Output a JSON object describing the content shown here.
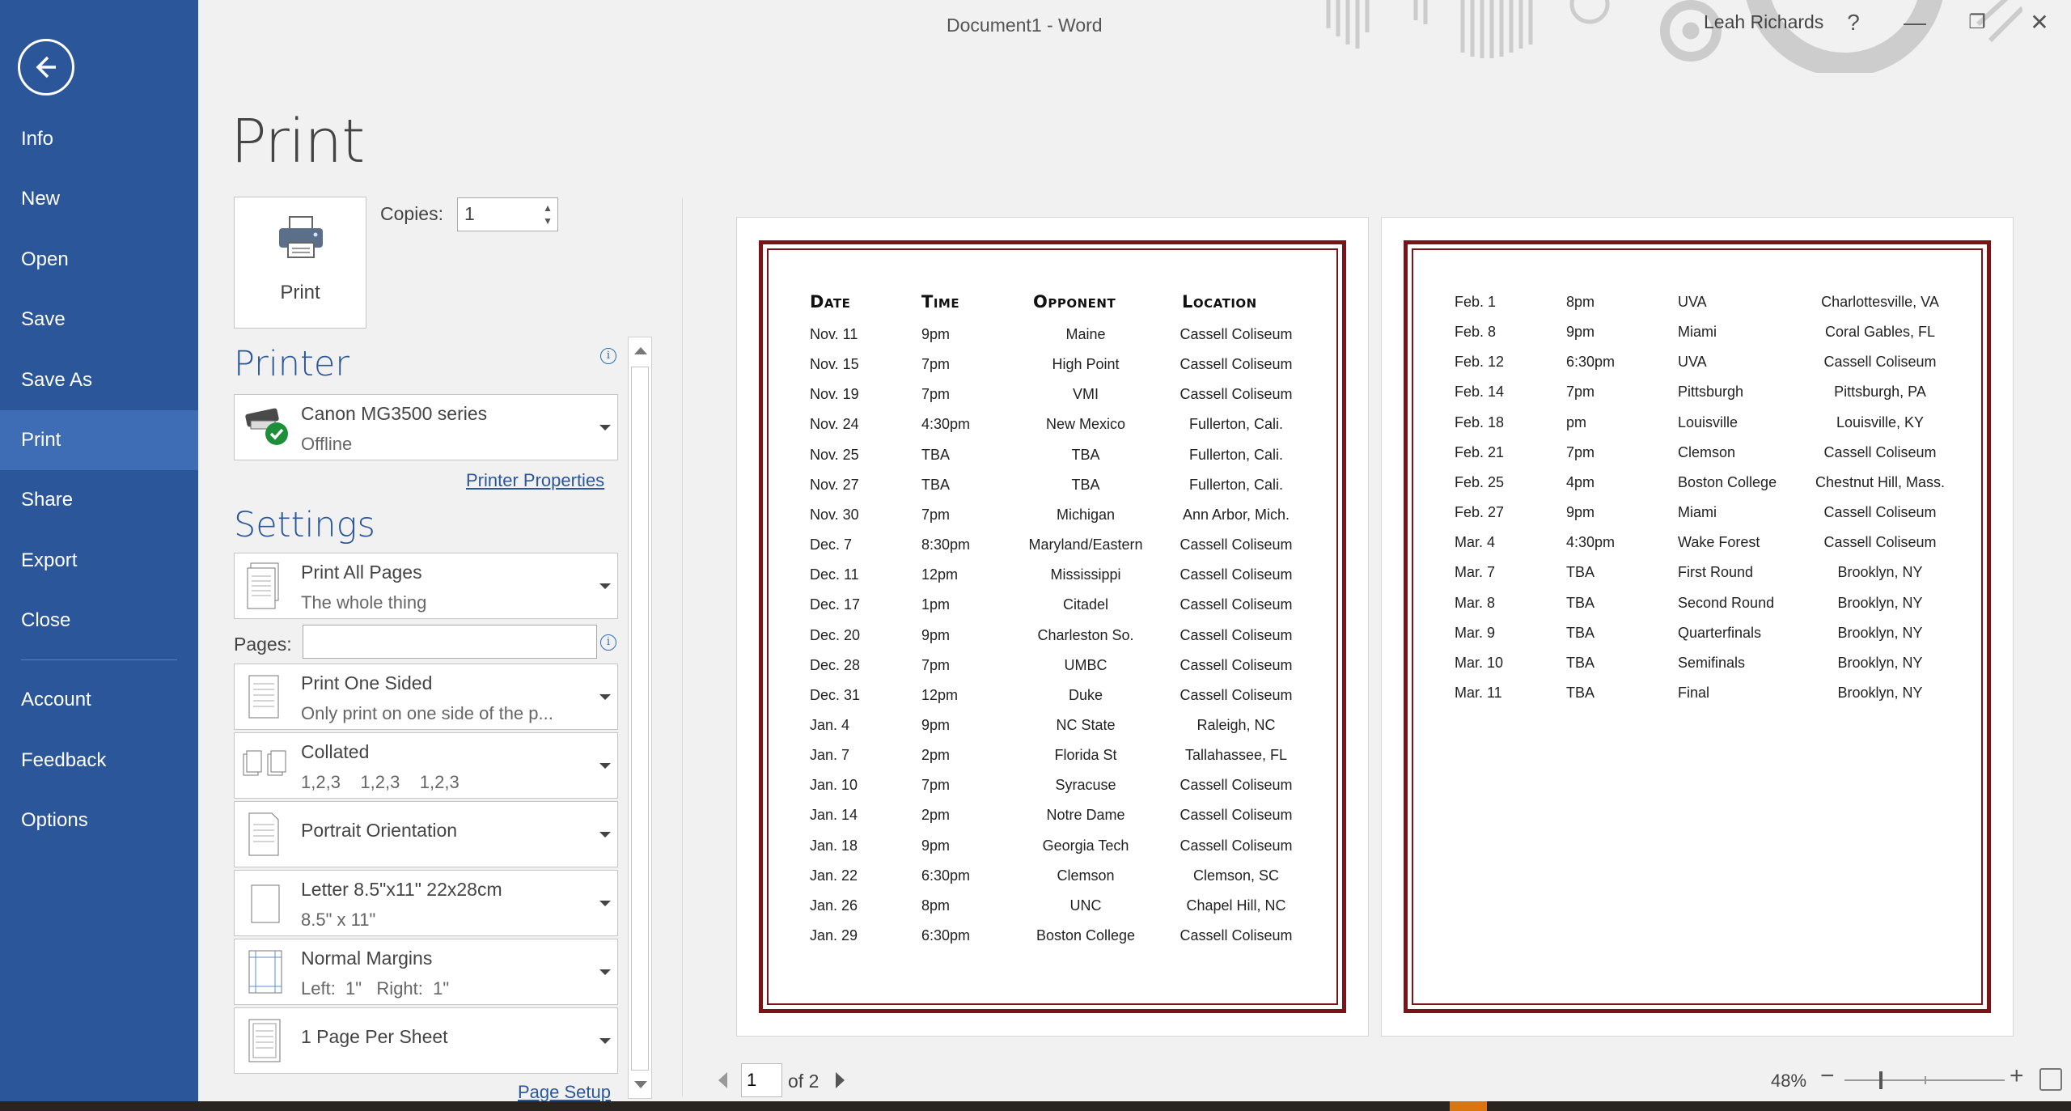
{
  "window": {
    "title": "Document1  -  Word",
    "user": "Leah Richards",
    "help": "?",
    "minimize": "—",
    "restore": "❐",
    "close": "✕"
  },
  "nav": {
    "back_icon": "back-arrow-icon",
    "items": [
      "Info",
      "New",
      "Open",
      "Save",
      "Save As",
      "Print",
      "Share",
      "Export",
      "Close",
      "Account",
      "Feedback",
      "Options"
    ],
    "active": "Print",
    "color": "#2b579a"
  },
  "print": {
    "heading": "Print",
    "button_label": "Print",
    "copies_label": "Copies:",
    "copies_value": "1"
  },
  "printer": {
    "title": "Printer",
    "name": "Canon MG3500 series",
    "status": "Offline",
    "properties_link": "Printer Properties"
  },
  "settings": {
    "title": "Settings",
    "pages_label": "Pages:",
    "pages_value": "",
    "options": [
      {
        "line1": "Print All Pages",
        "line2": "The whole thing"
      },
      {
        "line1": "Print One Sided",
        "line2": "Only print on one side of the p..."
      },
      {
        "line1": "Collated",
        "line2": "1,2,3    1,2,3    1,2,3"
      },
      {
        "line1": "Portrait Orientation",
        "line2": ""
      },
      {
        "line1": "Letter 8.5\"x11\" 22x28cm",
        "line2": "8.5\" x 11\""
      },
      {
        "line1": "Normal Margins",
        "line2": "Left:  1\"   Right:  1\""
      },
      {
        "line1": "1 Page Per Sheet",
        "line2": ""
      }
    ],
    "page_setup_link": "Page Setup"
  },
  "preview": {
    "page1": {
      "headers": [
        "Date",
        "Time",
        "Opponent",
        "Location"
      ],
      "rows": [
        [
          "Nov. 11",
          "9pm",
          "Maine",
          "Cassell Coliseum"
        ],
        [
          "Nov. 15",
          "7pm",
          "High Point",
          "Cassell Coliseum"
        ],
        [
          "Nov. 19",
          "7pm",
          "VMI",
          "Cassell Coliseum"
        ],
        [
          "Nov. 24",
          "4:30pm",
          "New Mexico",
          "Fullerton, Cali."
        ],
        [
          "Nov. 25",
          "TBA",
          "TBA",
          "Fullerton, Cali."
        ],
        [
          "Nov. 27",
          "TBA",
          "TBA",
          "Fullerton, Cali."
        ],
        [
          "Nov. 30",
          "7pm",
          "Michigan",
          "Ann Arbor, Mich."
        ],
        [
          "Dec. 7",
          "8:30pm",
          "Maryland/Eastern",
          "Cassell Coliseum"
        ],
        [
          "Dec. 11",
          "12pm",
          "Mississippi",
          "Cassell Coliseum"
        ],
        [
          "Dec. 17",
          "1pm",
          "Citadel",
          "Cassell Coliseum"
        ],
        [
          "Dec. 20",
          "9pm",
          "Charleston So.",
          "Cassell Coliseum"
        ],
        [
          "Dec. 28",
          "7pm",
          "UMBC",
          "Cassell Coliseum"
        ],
        [
          "Dec. 31",
          "12pm",
          "Duke",
          "Cassell Coliseum"
        ],
        [
          "Jan. 4",
          "9pm",
          "NC State",
          "Raleigh, NC"
        ],
        [
          "Jan. 7",
          "2pm",
          "Florida St",
          "Tallahassee, FL"
        ],
        [
          "Jan. 10",
          "7pm",
          "Syracuse",
          "Cassell Coliseum"
        ],
        [
          "Jan. 14",
          "2pm",
          "Notre Dame",
          "Cassell Coliseum"
        ],
        [
          "Jan. 18",
          "9pm",
          "Georgia Tech",
          "Cassell Coliseum"
        ],
        [
          "Jan. 22",
          "6:30pm",
          "Clemson",
          "Clemson, SC"
        ],
        [
          "Jan. 26",
          "8pm",
          "UNC",
          "Chapel Hill, NC"
        ],
        [
          "Jan. 29",
          "6:30pm",
          "Boston College",
          "Cassell Coliseum"
        ]
      ]
    },
    "page2": {
      "rows": [
        [
          "Feb. 1",
          "8pm",
          "UVA",
          "Charlottesville, VA"
        ],
        [
          "Feb. 8",
          "9pm",
          "Miami",
          "Coral Gables, FL"
        ],
        [
          "Feb. 12",
          "6:30pm",
          "UVA",
          "Cassell Coliseum"
        ],
        [
          "Feb. 14",
          "7pm",
          "Pittsburgh",
          "Pittsburgh, PA"
        ],
        [
          "Feb. 18",
          "pm",
          "Louisville",
          "Louisville, KY"
        ],
        [
          "Feb. 21",
          "7pm",
          "Clemson",
          "Cassell Coliseum"
        ],
        [
          "Feb. 25",
          "4pm",
          "Boston College",
          "Chestnut Hill, Mass."
        ],
        [
          "Feb. 27",
          "9pm",
          "Miami",
          "Cassell Coliseum"
        ],
        [
          "Mar. 4",
          "4:30pm",
          "Wake Forest",
          "Cassell Coliseum"
        ],
        [
          "Mar. 7",
          "TBA",
          "First Round",
          "Brooklyn, NY"
        ],
        [
          "Mar. 8",
          "TBA",
          "Second Round",
          "Brooklyn, NY"
        ],
        [
          "Mar. 9",
          "TBA",
          "Quarterfinals",
          "Brooklyn, NY"
        ],
        [
          "Mar. 10",
          "TBA",
          "Semifinals",
          "Brooklyn, NY"
        ],
        [
          "Mar. 11",
          "TBA",
          "Final",
          "Brooklyn, NY"
        ]
      ]
    },
    "border_color": "#7a1419"
  },
  "status": {
    "current_page": "1",
    "of_pages": "of 2",
    "zoom": "48%",
    "zoom_minus": "−",
    "zoom_plus": "+"
  }
}
